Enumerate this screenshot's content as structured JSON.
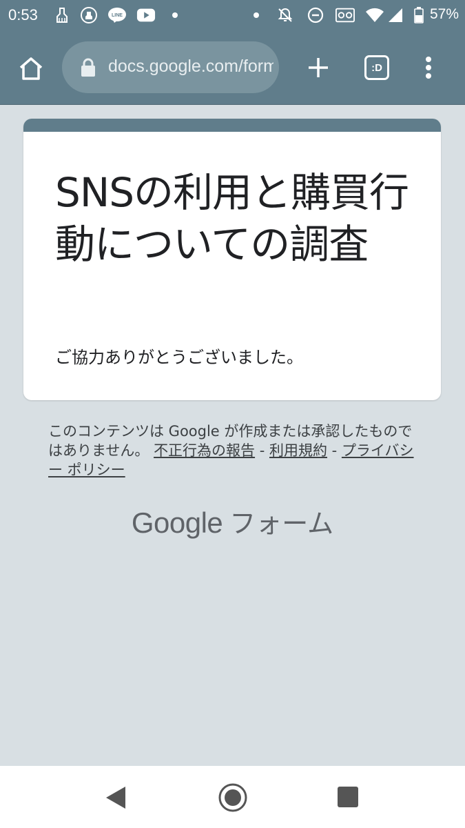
{
  "status_bar": {
    "time": "0:53",
    "battery_percent": "57%",
    "icons": [
      "broom-icon",
      "broom-badge-icon",
      "line-app-icon",
      "youtube-icon",
      "dot-icon",
      "dot-icon",
      "notifications-off-icon",
      "do-not-disturb-icon",
      "voicemail-icon",
      "wifi-icon",
      "signal-icon",
      "battery-icon"
    ]
  },
  "toolbar": {
    "url": "docs.google.com/forms",
    "tab_count": ":D"
  },
  "form": {
    "title": "SNSの利用と購買行動についての調査",
    "message": "ご協力ありがとうございました。",
    "stripe_color": "#607d8b"
  },
  "disclaimer": {
    "text": "このコンテンツは Google が作成または承認したものではありません。",
    "link_abuse": "不正行為の報告",
    "sep1": " - ",
    "link_terms": "利用規約",
    "sep2": " - ",
    "link_privacy": "プライバシー ポリシー"
  },
  "logo": {
    "google": "Google",
    "forms": "フォーム"
  },
  "colors": {
    "accent": "#607d8b",
    "background": "#d8dfe3"
  }
}
